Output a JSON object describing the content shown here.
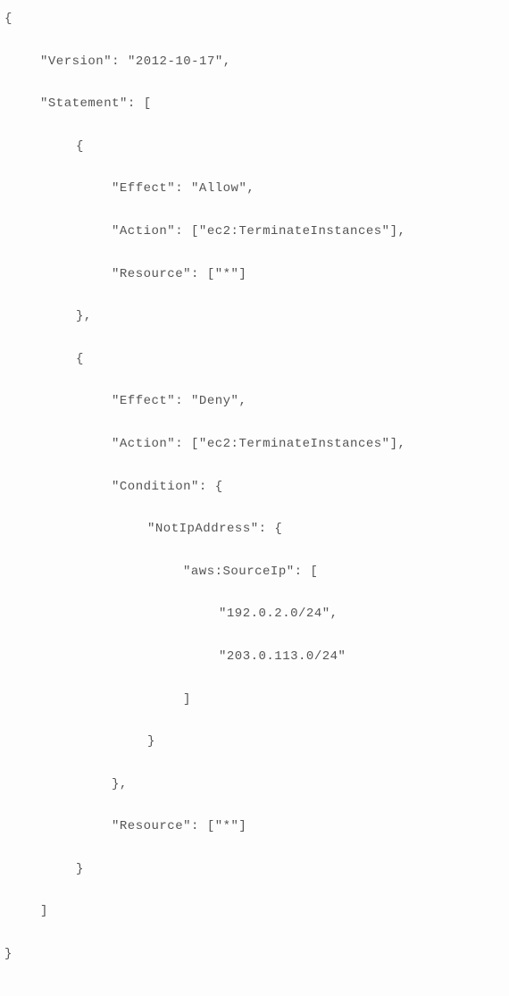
{
  "policy": {
    "version_key": "\"Version\"",
    "version_val": "\"2012-10-17\"",
    "statement_key": "\"Statement\"",
    "stmt0": {
      "effect_key": "\"Effect\"",
      "effect_val": "\"Allow\"",
      "action_key": "\"Action\"",
      "action_val": "[\"ec2:TerminateInstances\"]",
      "resource_key": "\"Resource\"",
      "resource_val": "[\"*\"]"
    },
    "stmt1": {
      "effect_key": "\"Effect\"",
      "effect_val": "\"Deny\"",
      "action_key": "\"Action\"",
      "action_val": "[\"ec2:TerminateInstances\"]",
      "condition_key": "\"Condition\"",
      "notip_key": "\"NotIpAddress\"",
      "sourceip_key": "\"aws:SourceIp\"",
      "ip0": "\"192.0.2.0/24\"",
      "ip1": "\"203.0.113.0/24\"",
      "resource_key": "\"Resource\"",
      "resource_val": "[\"*\"]"
    }
  },
  "sym": {
    "open_brace": "{",
    "close_brace": "}",
    "close_brace_comma": "},",
    "open_bracket": "[",
    "close_bracket": "]",
    "colon_space": ": ",
    "colon_open_bracket": ": [",
    "colon_open_brace": ": {",
    "comma": ","
  }
}
